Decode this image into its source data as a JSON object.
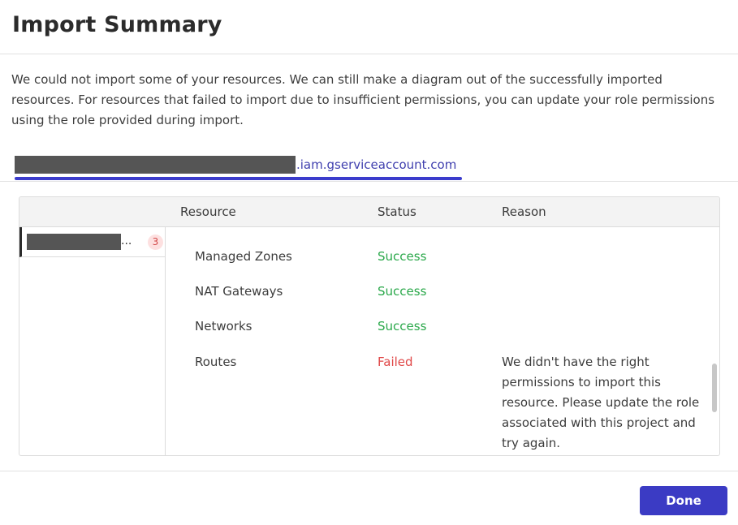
{
  "dialog": {
    "title": "Import Summary",
    "description": "We could not import some of your resources. We can still make a diagram out of the successfully imported resources. For resources that failed to import due to insufficient permissions, you can update your role permissions using the role provided during import."
  },
  "account_tab": {
    "domain": ".iam.gserviceaccount.com",
    "underline_color": "#3b3ccc"
  },
  "table": {
    "columns": {
      "resource": "Resource",
      "status": "Status",
      "reason": "Reason"
    },
    "project": {
      "ellipsis": "...",
      "count": "3"
    },
    "rows": [
      {
        "resource": "Managed Zones",
        "status": "Success",
        "reason": ""
      },
      {
        "resource": "NAT Gateways",
        "status": "Success",
        "reason": ""
      },
      {
        "resource": "Networks",
        "status": "Success",
        "reason": ""
      },
      {
        "resource": "Routes",
        "status": "Failed",
        "reason": "We didn't have the right permissions to import this resource. Please update the role associated with this project and try again."
      }
    ],
    "status_colors": {
      "success": "#2aa84a",
      "failed": "#e04848"
    }
  },
  "footer": {
    "done_label": "Done",
    "accent": "#3b3bc4"
  }
}
